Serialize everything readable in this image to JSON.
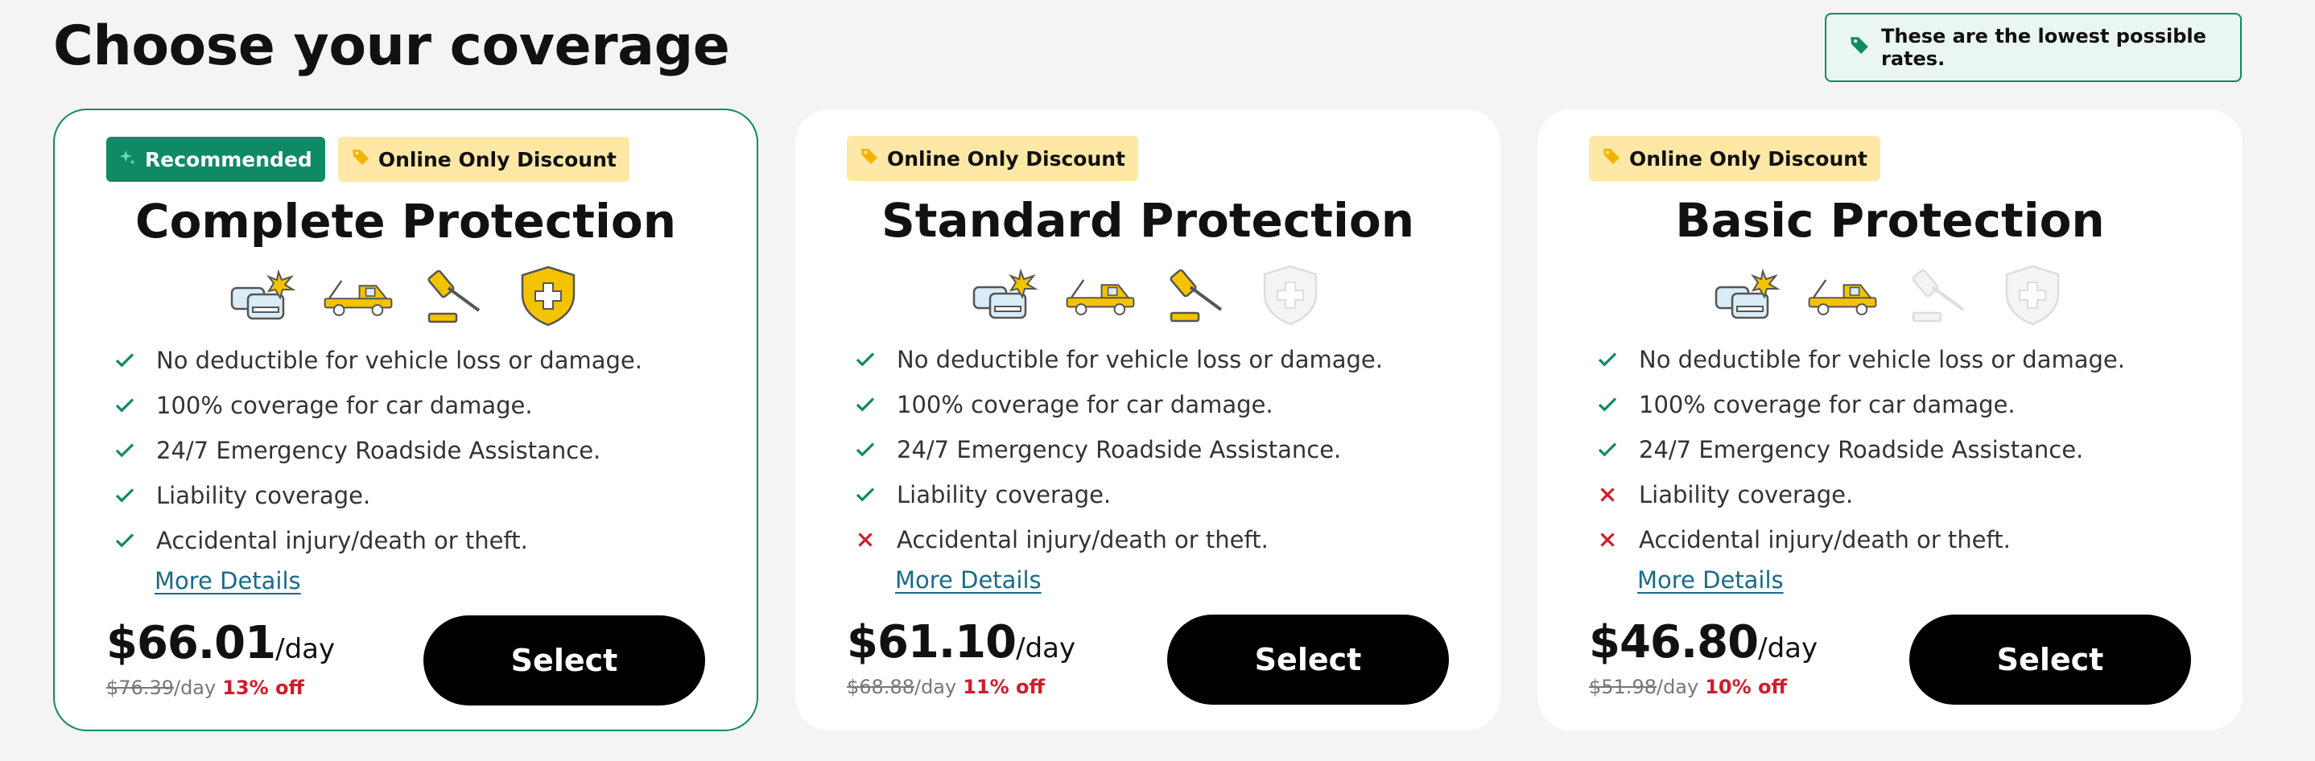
{
  "header": {
    "title": "Choose your coverage",
    "note": "These are the lowest possible rates."
  },
  "colors": {
    "accent": "#0e8a65",
    "discount": "#ffe8a6",
    "danger": "#d11c2b",
    "link": "#1a6a8a"
  },
  "plans": [
    {
      "title": "Complete Protection",
      "recommended_badge": "Recommended",
      "discount_badge": "Online Only Discount",
      "icons": [
        {
          "name": "car-collision-icon",
          "active": true
        },
        {
          "name": "tow-truck-icon",
          "active": true
        },
        {
          "name": "gavel-icon",
          "active": true
        },
        {
          "name": "medical-shield-icon",
          "active": true
        }
      ],
      "features": [
        {
          "text": "No deductible for vehicle loss or damage.",
          "included": true
        },
        {
          "text": "100% coverage for car damage.",
          "included": true
        },
        {
          "text": "24/7 Emergency Roadside Assistance.",
          "included": true
        },
        {
          "text": "Liability coverage.",
          "included": true
        },
        {
          "text": "Accidental injury/death or theft.",
          "included": true
        }
      ],
      "more_details": "More Details",
      "price": "$66.01",
      "per": "/day",
      "old_price": "$76.39",
      "old_per": "/day",
      "discount": "13% off",
      "select": "Select"
    },
    {
      "title": "Standard Protection",
      "discount_badge": "Online Only Discount",
      "icons": [
        {
          "name": "car-collision-icon",
          "active": true
        },
        {
          "name": "tow-truck-icon",
          "active": true
        },
        {
          "name": "gavel-icon",
          "active": true
        },
        {
          "name": "medical-shield-icon",
          "active": false
        }
      ],
      "features": [
        {
          "text": "No deductible for vehicle loss or damage.",
          "included": true
        },
        {
          "text": "100% coverage for car damage.",
          "included": true
        },
        {
          "text": "24/7 Emergency Roadside Assistance.",
          "included": true
        },
        {
          "text": "Liability coverage.",
          "included": true
        },
        {
          "text": "Accidental injury/death or theft.",
          "included": false
        }
      ],
      "more_details": "More Details",
      "price": "$61.10",
      "per": "/day",
      "old_price": "$68.88",
      "old_per": "/day",
      "discount": "11% off",
      "select": "Select"
    },
    {
      "title": "Basic Protection",
      "discount_badge": "Online Only Discount",
      "icons": [
        {
          "name": "car-collision-icon",
          "active": true
        },
        {
          "name": "tow-truck-icon",
          "active": true
        },
        {
          "name": "gavel-icon",
          "active": false
        },
        {
          "name": "medical-shield-icon",
          "active": false
        }
      ],
      "features": [
        {
          "text": "No deductible for vehicle loss or damage.",
          "included": true
        },
        {
          "text": "100% coverage for car damage.",
          "included": true
        },
        {
          "text": "24/7 Emergency Roadside Assistance.",
          "included": true
        },
        {
          "text": "Liability coverage.",
          "included": false
        },
        {
          "text": "Accidental injury/death or theft.",
          "included": false
        }
      ],
      "more_details": "More Details",
      "price": "$46.80",
      "per": "/day",
      "old_price": "$51.98",
      "old_per": "/day",
      "discount": "10% off",
      "select": "Select"
    }
  ]
}
